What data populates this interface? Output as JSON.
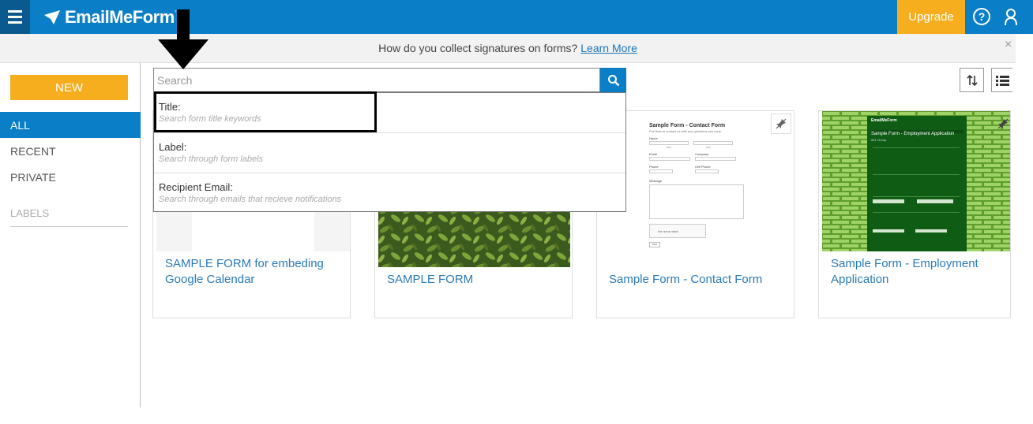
{
  "header": {
    "logo_text": "EmailMeForm",
    "logo_tm": "™",
    "upgrade_label": "Upgrade",
    "help_glyph": "?"
  },
  "banner": {
    "text": "How do you collect signatures on forms?",
    "link_text": "Learn More",
    "close_glyph": "×"
  },
  "sidebar": {
    "new_label": "NEW",
    "items": [
      {
        "label": "ALL",
        "active": true
      },
      {
        "label": "RECENT",
        "active": false
      },
      {
        "label": "PRIVATE",
        "active": false
      }
    ],
    "labels_heading": "LABELS"
  },
  "search": {
    "placeholder": "Search",
    "options": [
      {
        "title": "Title:",
        "hint": "Search form title keywords"
      },
      {
        "title": "Label:",
        "hint": "Search through form labels"
      },
      {
        "title": "Recipient Email:",
        "hint": "Search through emails that recieve notifications"
      }
    ]
  },
  "cards": [
    {
      "title": "SAMPLE FORM for embeding Google Calendar"
    },
    {
      "title": "SAMPLE FORM"
    },
    {
      "title": "Sample Form - Contact Form"
    },
    {
      "title": "Sample Form - Employment Application"
    }
  ],
  "thumbs": {
    "contact_form": {
      "heading": "Sample Form - Contact Form",
      "sub": "Feel free to contact us with any questions you have.",
      "fields": [
        "Name",
        "First",
        "Last",
        "Email",
        "Company",
        "Phone",
        "Cell Phone",
        "Message"
      ],
      "captcha": "I'm not a robot",
      "submit": "Sent"
    },
    "employment": {
      "logo": "EmailMeForm",
      "heading": "Sample Form - Employment Application",
      "sub": "#EL Group"
    }
  },
  "colors": {
    "brand_blue": "#0a7fc7",
    "accent_orange": "#f6ae1f",
    "link_blue": "#2a7ab8"
  }
}
